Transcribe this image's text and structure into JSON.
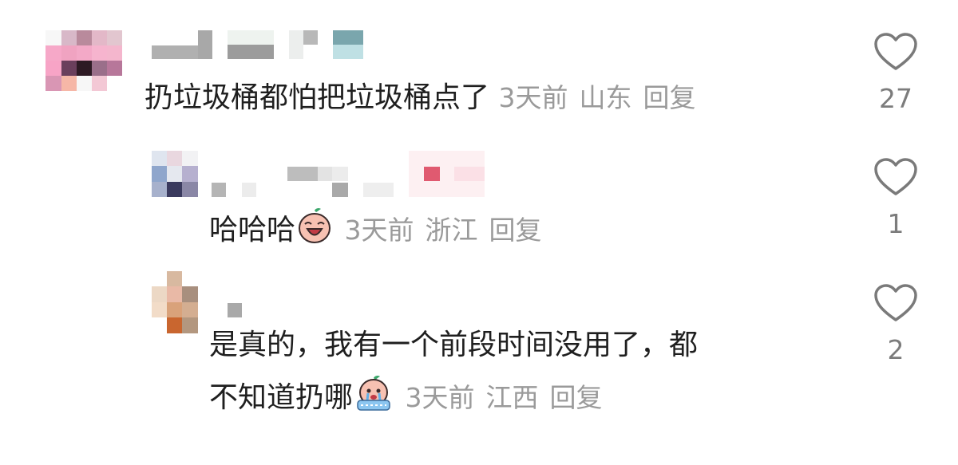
{
  "colors": {
    "text": "#1f1f1f",
    "meta": "#9a9a9a",
    "icon": "#7a7a7a"
  },
  "comments": [
    {
      "text": "扔垃圾桶都怕把垃圾桶点了",
      "time": "3天前",
      "location": "山东",
      "reply_label": "回复",
      "likes": "27",
      "like_icon": "heart-outline-icon"
    },
    {
      "text": "哈哈哈",
      "emoji": "crying-laughing-peach-emoji",
      "time": "3天前",
      "location": "浙江",
      "reply_label": "回复",
      "likes": "1",
      "like_icon": "heart-outline-icon"
    },
    {
      "text_line1": "是真的，我有一个前段时间没用了，都",
      "text_line2": "不知道扔哪",
      "emoji": "crying-peach-emoji",
      "time": "3天前",
      "location": "江西",
      "reply_label": "回复",
      "likes": "2",
      "like_icon": "heart-outline-icon"
    }
  ]
}
